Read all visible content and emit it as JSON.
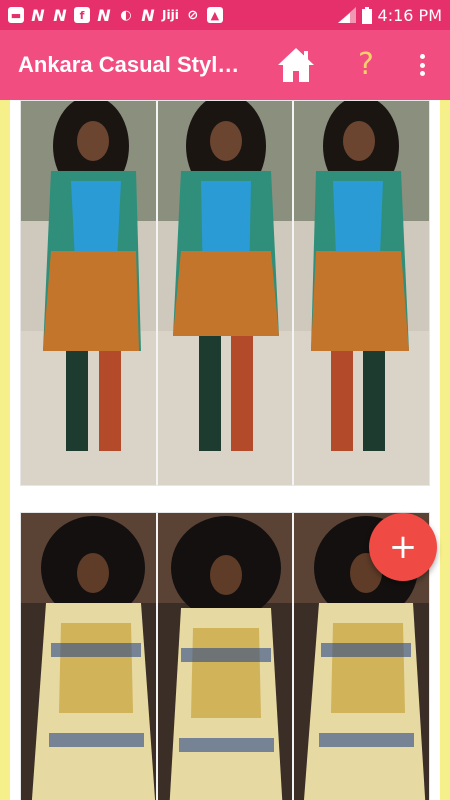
{
  "status_bar": {
    "time": "4:16 PM",
    "left_icons": [
      "message-icon",
      "notification-n-icon",
      "notification-n-icon",
      "facebook-icon",
      "notification-n-icon",
      "swirl-app-icon",
      "notification-n-icon",
      "jiji-icon",
      "compass-icon",
      "image-icon"
    ],
    "jiji_label": "Jiji",
    "right_icons": [
      "signal-icon",
      "battery-icon"
    ]
  },
  "app_bar": {
    "title": "Ankara Casual Styl…",
    "background": "#f24d80",
    "actions": [
      "home-icon",
      "help-icon",
      "more-vert-icon"
    ],
    "help_glyph": "?"
  },
  "feed": {
    "items": [
      {
        "name": "ankara-outfit-photo-1",
        "description_icon": "photo-image"
      },
      {
        "name": "ankara-outfit-photo-2",
        "description_icon": "photo-image"
      }
    ]
  },
  "fab": {
    "glyph": "+",
    "color": "#f04a45"
  }
}
